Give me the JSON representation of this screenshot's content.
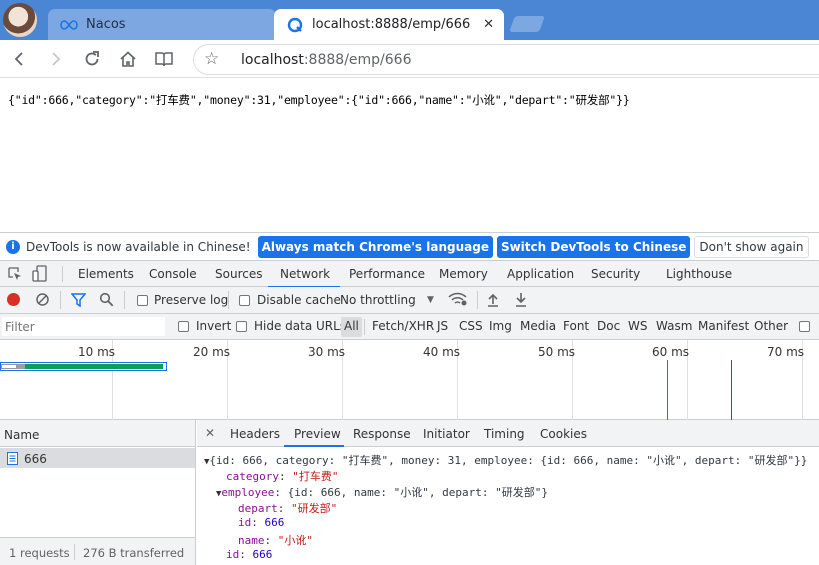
{
  "browser": {
    "tabs": [
      {
        "title": "Nacos",
        "icon": "infinity-icon",
        "active": false
      },
      {
        "title": "localhost:8888/emp/666",
        "icon": "loading-icon",
        "active": true
      }
    ],
    "url_host": "localhost",
    "url_rest": ":8888/emp/666"
  },
  "page": {
    "json_text": "{\"id\":666,\"category\":\"打车费\",\"money\":31,\"employee\":{\"id\":666,\"name\":\"小讹\",\"depart\":\"研发部\"}}"
  },
  "devtools": {
    "infobar": {
      "message": "DevTools is now available in Chinese!",
      "btn_match": "Always match Chrome's language",
      "btn_switch": "Switch DevTools to Chinese",
      "btn_dismiss": "Don't show again"
    },
    "tabs": [
      "Elements",
      "Console",
      "Sources",
      "Network",
      "Performance",
      "Memory",
      "Application",
      "Security",
      "Lighthouse"
    ],
    "active_tab": "Network",
    "network_toolbar": {
      "preserve_log": "Preserve log",
      "disable_cache": "Disable cache",
      "throttling": "No throttling"
    },
    "filter": {
      "placeholder": "Filter",
      "invert": "Invert",
      "hide_data_urls": "Hide data URLs",
      "types": [
        "All",
        "Fetch/XHR",
        "JS",
        "CSS",
        "Img",
        "Media",
        "Font",
        "Doc",
        "WS",
        "Wasm",
        "Manifest",
        "Other"
      ]
    },
    "timeline_labels": [
      "10 ms",
      "20 ms",
      "30 ms",
      "40 ms",
      "50 ms",
      "60 ms",
      "70 ms"
    ],
    "requests": {
      "header": "Name",
      "items": [
        "666"
      ],
      "status_requests": "1 requests",
      "status_transferred": "276 B transferred"
    },
    "detail_tabs": [
      "Headers",
      "Preview",
      "Response",
      "Initiator",
      "Timing",
      "Cookies"
    ],
    "active_detail_tab": "Preview",
    "preview": {
      "summary": "{id: 666, category: \"打车费\", money: 31, employee: {id: 666, name: \"小讹\", depart: \"研发部\"}}",
      "category_key": "category",
      "category_val": "\"打车费\"",
      "employee_key": "employee",
      "employee_summary": "{id: 666, name: \"小讹\", depart: \"研发部\"}",
      "depart_key": "depart",
      "depart_val": "\"研发部\"",
      "emp_id_key": "id",
      "emp_id_val": "666",
      "name_key": "name",
      "name_val": "\"小讹\"",
      "id_key": "id",
      "id_val": "666"
    }
  }
}
